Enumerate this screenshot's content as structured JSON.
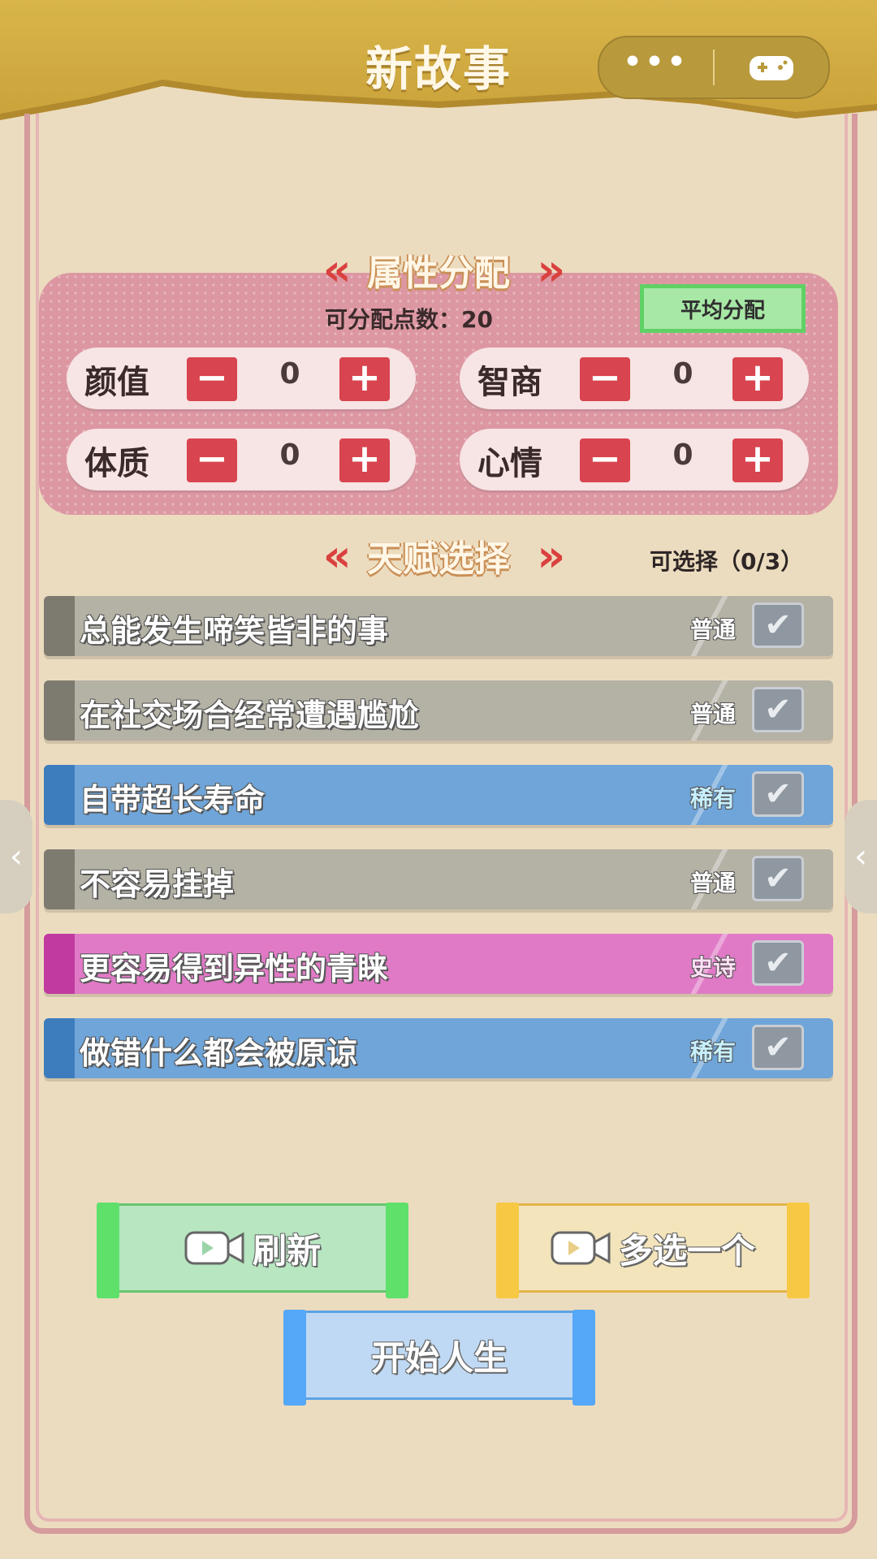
{
  "header": {
    "title": "新故事",
    "more_glyph": "•••",
    "game_icon": "gamepad-icon"
  },
  "attributes": {
    "title": "属性分配",
    "points_label": "可分配点数：20",
    "avg_button": "平均分配",
    "minus_glyph": "−",
    "plus_glyph": "+",
    "stats": [
      {
        "name": "颜值",
        "value": "0"
      },
      {
        "name": "智商",
        "value": "0"
      },
      {
        "name": "体质",
        "value": "0"
      },
      {
        "name": "心情",
        "value": "0"
      }
    ]
  },
  "talents": {
    "title": "天赋选择",
    "select_count": "可选择（0/3）",
    "items": [
      {
        "label": "总能发生啼笑皆非的事",
        "rarity": "普通"
      },
      {
        "label": "在社交场合经常遭遇尴尬",
        "rarity": "普通"
      },
      {
        "label": "自带超长寿命",
        "rarity": "稀有"
      },
      {
        "label": "不容易挂掉",
        "rarity": "普通"
      },
      {
        "label": "更容易得到异性的青睐",
        "rarity": "史诗"
      },
      {
        "label": "做错什么都会被原谅",
        "rarity": "稀有"
      }
    ],
    "check_glyph": "✔"
  },
  "actions": {
    "refresh": "刷新",
    "choose_more": "多选一个",
    "start": "开始人生"
  },
  "side_arrows": {
    "left": "‹",
    "right": "‹"
  },
  "colors": {
    "normal": "#b4b1a5",
    "rare": "#6fa5d9",
    "epic": "#e07ac6",
    "accent_red": "#d9413f"
  }
}
